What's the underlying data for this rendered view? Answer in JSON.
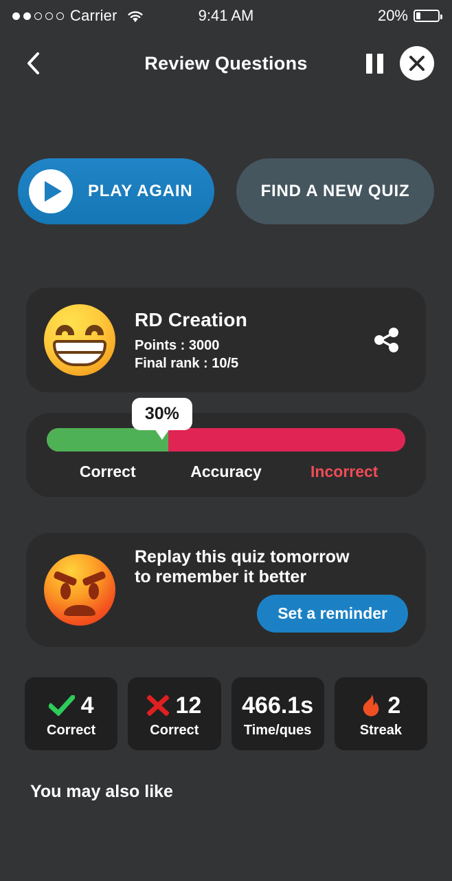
{
  "status_bar": {
    "carrier": "Carrier",
    "signal_filled": 2,
    "signal_total": 5,
    "wifi_icon": "wifi-icon",
    "time": "9:41 AM",
    "battery_percent": "20%",
    "battery_level": 20
  },
  "header": {
    "back_icon": "chevron-left-icon",
    "title": "Review Questions",
    "pause_icon": "pause-icon",
    "close_icon": "close-icon"
  },
  "actions": {
    "play_again": {
      "label": "PLAY AGAIN",
      "icon": "play-icon",
      "color": "#1d7fbf"
    },
    "find_new_quiz": {
      "label": "FIND A NEW QUIZ",
      "color": "#45565f"
    }
  },
  "profile": {
    "avatar_icon": "grinning-face-emoji",
    "name": "RD Creation",
    "points": "Points : 3000",
    "final_rank": "Final rank : 10/5",
    "share_icon": "share-icon"
  },
  "accuracy": {
    "tooltip": "30%",
    "correct_label": "Correct",
    "middle_label": "Accuracy",
    "incorrect_label": "Incorrect",
    "correct_percent": 34,
    "incorrect_percent": 66,
    "correct_color": "#4fb155",
    "incorrect_color": "#e02454",
    "incorrect_label_color": "#ef4c55"
  },
  "reminder": {
    "avatar_icon": "angry-face-emoji",
    "text": "Replay this quiz tomorrow to remember it better",
    "button_label": "Set a reminder",
    "button_color": "#1c81c4"
  },
  "stats": [
    {
      "icon": "check-icon",
      "icon_color": "#2ecc5a",
      "value": "4",
      "label": "Correct"
    },
    {
      "icon": "cross-icon",
      "icon_color": "#e02020",
      "value": "12",
      "label": "Correct"
    },
    {
      "icon": "none",
      "icon_color": "",
      "value": "466.1s",
      "label": "Time/ques"
    },
    {
      "icon": "fire-icon",
      "icon_color": "#f04f23",
      "value": "2",
      "label": "Streak"
    }
  ],
  "footer": {
    "also_like_title": "You may also like"
  }
}
